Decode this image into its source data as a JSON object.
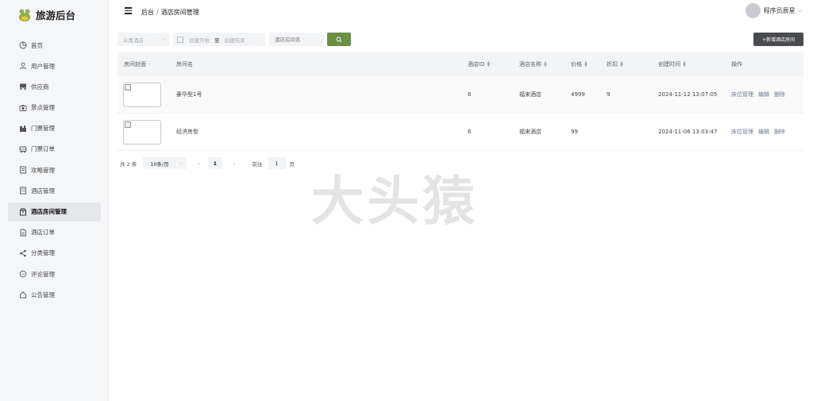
{
  "app": {
    "title": "旅游后台"
  },
  "sidebar": {
    "items": [
      {
        "label": "首页",
        "icon": "pie-chart-icon"
      },
      {
        "label": "用户管理",
        "icon": "user-icon"
      },
      {
        "label": "供应商",
        "icon": "truck-icon"
      },
      {
        "label": "景点管理",
        "icon": "camera-icon"
      },
      {
        "label": "门票管理",
        "icon": "ticket-icon"
      },
      {
        "label": "门票订单",
        "icon": "bus-icon"
      },
      {
        "label": "攻略管理",
        "icon": "notebook-icon"
      },
      {
        "label": "酒店管理",
        "icon": "building-icon"
      },
      {
        "label": "酒店房间管理",
        "icon": "box-icon",
        "active": true
      },
      {
        "label": "酒店订单",
        "icon": "document-icon"
      },
      {
        "label": "分类管理",
        "icon": "share-icon"
      },
      {
        "label": "评论管理",
        "icon": "chat-icon"
      },
      {
        "label": "公告管理",
        "icon": "house-icon"
      }
    ]
  },
  "header": {
    "breadcrumb": [
      "后台",
      "酒店房间管理"
    ],
    "user": {
      "name": "程序员辰星"
    }
  },
  "filters": {
    "hotel_select_placeholder": "从属酒店",
    "date_start_placeholder": "创建开始",
    "date_separator": "至",
    "date_end_placeholder": "创建结束",
    "name_placeholder": "酒店房间名",
    "add_button": "+新增酒店房间"
  },
  "table": {
    "columns": [
      "房间封面",
      "房间名",
      "酒店ID",
      "酒店名称",
      "价格",
      "折扣",
      "创建时间",
      "操作"
    ],
    "rows": [
      {
        "name": "豪华型1号",
        "hotel_id": "6",
        "hotel_name": "福来酒店",
        "price": "4999",
        "discount": "9",
        "created": "2024-11-12 13:07:05",
        "ops": [
          "床位管理",
          "编辑",
          "删除"
        ]
      },
      {
        "name": "经济房型",
        "hotel_id": "6",
        "hotel_name": "福来酒店",
        "price": "99",
        "discount": "",
        "created": "2024-11-06 13:03:47",
        "ops": [
          "床位管理",
          "编辑",
          "删除"
        ]
      }
    ]
  },
  "pagination": {
    "total": "共 2 条",
    "page_size": "10条/页",
    "current_page": "1",
    "goto_label": "前往",
    "goto_value": "1",
    "page_unit": "页"
  },
  "watermark": "大头猿",
  "colors": {
    "accent": "#6c8f45",
    "dark_button": "#4a4b4e",
    "sidebar_bg": "#f5f6f8"
  }
}
